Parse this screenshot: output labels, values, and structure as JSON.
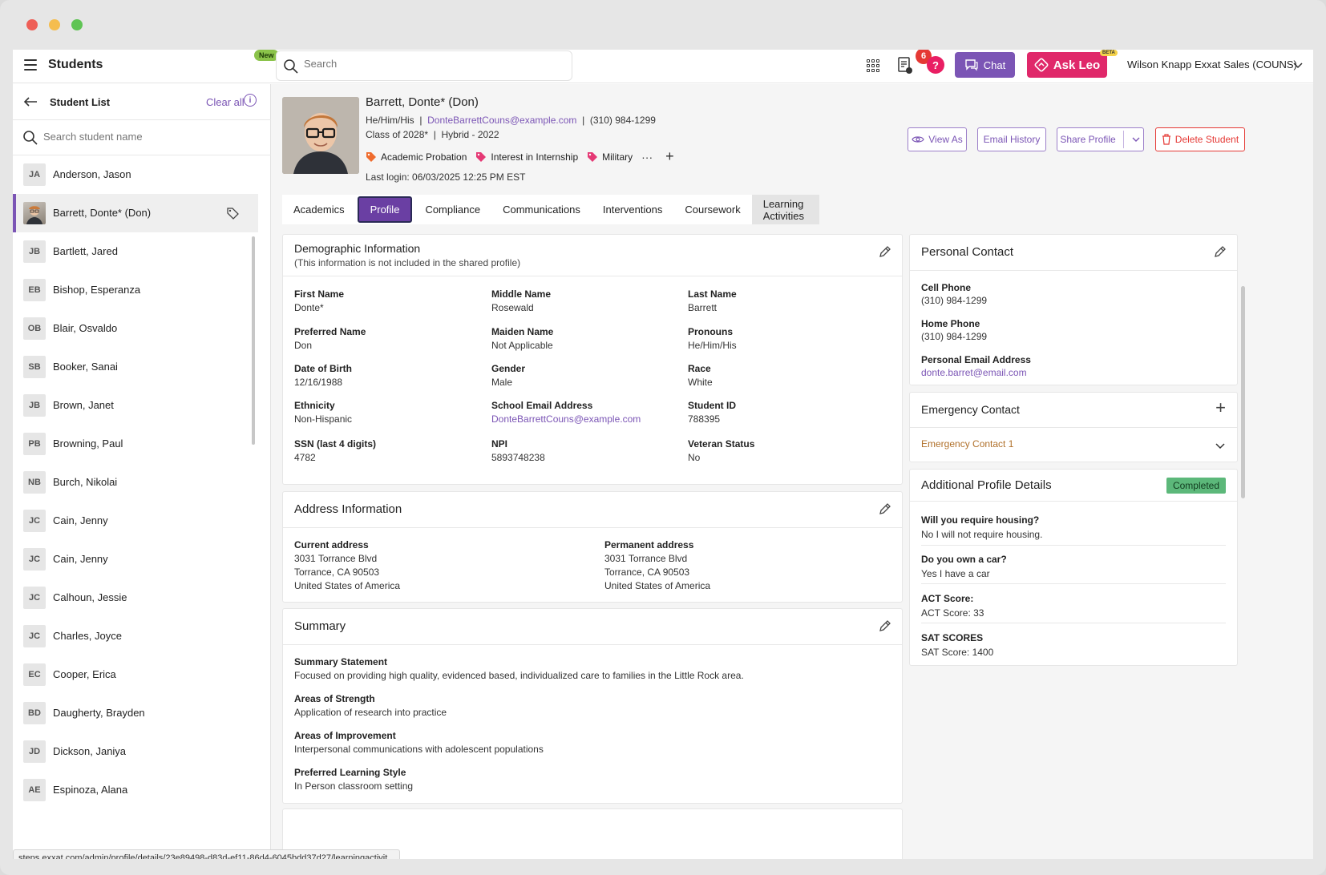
{
  "window": {
    "title": "Students"
  },
  "topbar": {
    "app_title": "Students",
    "new_badge": "New",
    "search_placeholder": "Search",
    "notification_count": "6",
    "help_label": "?",
    "chat_label": "Chat",
    "ask_leo_label": "Ask Leo",
    "beta_label": "BETA",
    "user_name": "Wilson Knapp",
    "org_name": "Exxat Sales (COUNS)"
  },
  "sidebar": {
    "title": "Student List",
    "clear_all": "Clear all",
    "info": "i",
    "search_placeholder": "Search student name",
    "students": [
      {
        "initials": "JA",
        "name": "Anderson, Jason"
      },
      {
        "initials": "",
        "name": "Barrett, Donte* (Don)",
        "active": true
      },
      {
        "initials": "JB",
        "name": "Bartlett, Jared"
      },
      {
        "initials": "EB",
        "name": "Bishop, Esperanza"
      },
      {
        "initials": "OB",
        "name": "Blair, Osvaldo"
      },
      {
        "initials": "SB",
        "name": "Booker, Sanai"
      },
      {
        "initials": "JB",
        "name": "Brown, Janet"
      },
      {
        "initials": "PB",
        "name": "Browning, Paul"
      },
      {
        "initials": "NB",
        "name": "Burch, Nikolai"
      },
      {
        "initials": "JC",
        "name": "Cain, Jenny"
      },
      {
        "initials": "JC",
        "name": "Cain, Jenny"
      },
      {
        "initials": "JC",
        "name": "Calhoun, Jessie"
      },
      {
        "initials": "JC",
        "name": "Charles, Joyce"
      },
      {
        "initials": "EC",
        "name": "Cooper, Erica"
      },
      {
        "initials": "BD",
        "name": "Daugherty, Brayden"
      },
      {
        "initials": "JD",
        "name": "Dickson, Janiya"
      },
      {
        "initials": "AE",
        "name": "Espinoza, Alana"
      }
    ]
  },
  "student": {
    "name": "Barrett, Donte* (Don)",
    "pronouns": "He/Him/His",
    "email": "DonteBarrettCouns@example.com",
    "phone": "(310) 984-1299",
    "class": "Class of 2028*",
    "program": "Hybrid - 2022",
    "separator": "|",
    "tags": [
      "Academic Probation",
      "Interest in Internship",
      "Military"
    ],
    "more": "···",
    "add": "+",
    "last_login": "Last login: 06/03/2025 12:25 PM EST"
  },
  "actions": {
    "view_as": "View As",
    "email_history": "Email History",
    "share_profile": "Share Profile",
    "delete_student": "Delete Student"
  },
  "tabs": [
    "Academics",
    "Profile",
    "Compliance",
    "Communications",
    "Interventions",
    "Coursework",
    "Learning Activities"
  ],
  "demographic": {
    "title": "Demographic Information",
    "subtitle": "(This information is not included in the shared profile)",
    "fields": [
      {
        "label": "First Name",
        "value": "Donte*"
      },
      {
        "label": "Middle Name",
        "value": "Rosewald"
      },
      {
        "label": "Last Name",
        "value": "Barrett"
      },
      {
        "label": "Preferred Name",
        "value": "Don"
      },
      {
        "label": "Maiden Name",
        "value": "Not Applicable"
      },
      {
        "label": "Pronouns",
        "value": "He/Him/His"
      },
      {
        "label": "Date of Birth",
        "value": "12/16/1988"
      },
      {
        "label": "Gender",
        "value": "Male"
      },
      {
        "label": "Race",
        "value": "White"
      },
      {
        "label": "Ethnicity",
        "value": "Non-Hispanic"
      },
      {
        "label": "School Email Address",
        "value": "DonteBarrettCouns@example.com"
      },
      {
        "label": "Student ID",
        "value": "788395"
      },
      {
        "label": "SSN (last 4 digits)",
        "value": "4782"
      },
      {
        "label": "NPI",
        "value": "5893748238"
      },
      {
        "label": "Veteran Status",
        "value": "No"
      }
    ]
  },
  "address": {
    "title": "Address Information",
    "current": {
      "label": "Current address",
      "line1": "3031 Torrance Blvd",
      "line2": "Torrance, CA 90503",
      "line3": "United States of America"
    },
    "permanent": {
      "label": "Permanent address",
      "line1": "3031 Torrance Blvd",
      "line2": "Torrance, CA 90503",
      "line3": "United States of America"
    }
  },
  "summary": {
    "title": "Summary",
    "items": [
      {
        "label": "Summary Statement",
        "value": "Focused on providing high quality, evidenced based, individualized care to families in the Little Rock area."
      },
      {
        "label": "Areas of Strength",
        "value": "Application of research into practice"
      },
      {
        "label": "Areas of Improvement",
        "value": "Interpersonal communications with adolescent populations"
      },
      {
        "label": "Preferred Learning Style",
        "value": "In Person classroom setting"
      }
    ]
  },
  "personal_contact": {
    "title": "Personal Contact",
    "cell_label": "Cell Phone",
    "cell": "(310) 984-1299",
    "home_label": "Home Phone",
    "home": "(310) 984-1299",
    "email_label": "Personal Email Address",
    "email": "donte.barret@email.com"
  },
  "emergency_contact": {
    "title": "Emergency Contact",
    "add": "+",
    "item": "Emergency Contact 1"
  },
  "additional": {
    "title": "Additional Profile Details",
    "status": "Completed",
    "qa": [
      {
        "q": "Will you require housing?",
        "a": "No I will not require housing."
      },
      {
        "q": "Do you own a car?",
        "a": "Yes I have a car"
      },
      {
        "q": "ACT Score:",
        "a": "ACT Score: 33"
      },
      {
        "q": "SAT SCORES",
        "a": "SAT Score: 1400"
      }
    ]
  },
  "status_url": "steps.exxat.com/admin/profile/details/23e89498-d83d-ef11-86d4-6045bdd37d27/learningactivit..."
}
